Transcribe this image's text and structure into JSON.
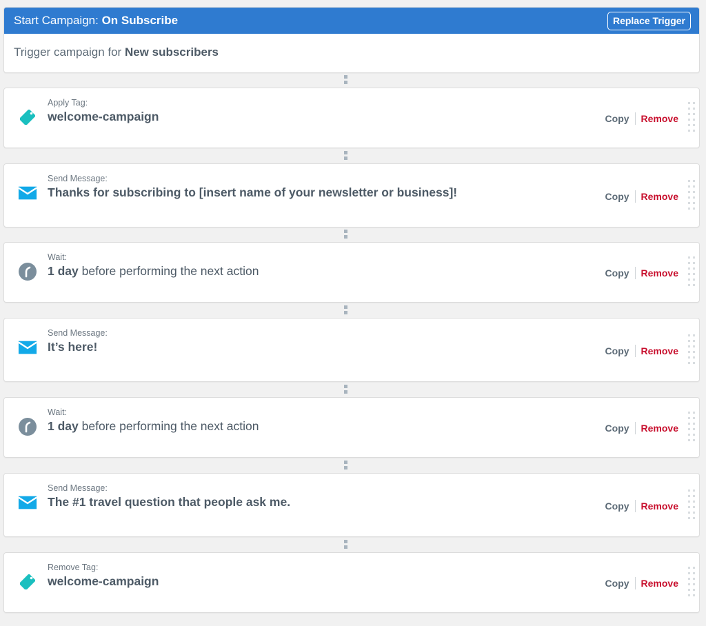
{
  "trigger": {
    "title_prefix": "Start Campaign:",
    "title_value": "On Subscribe",
    "replace_button": "Replace Trigger",
    "body_prefix": "Trigger campaign for",
    "body_value": "New subscribers",
    "header_color": "#2f7bd0"
  },
  "action_labels": {
    "copy": "Copy",
    "remove": "Remove"
  },
  "colors": {
    "tag_icon": "#1abfbf",
    "mail_icon": "#12a9e8",
    "clock_icon": "#7b8e9c",
    "remove": "#c8102e"
  },
  "steps": [
    {
      "type": "tag",
      "icon": "tag-icon",
      "label": "Apply Tag:",
      "value": "welcome-campaign",
      "suffix": ""
    },
    {
      "type": "message",
      "icon": "mail-icon",
      "label": "Send Message:",
      "value": "Thanks for subscribing to [insert name of your newsletter or business]!",
      "suffix": ""
    },
    {
      "type": "wait",
      "icon": "clock-icon",
      "label": "Wait:",
      "value": "1 day",
      "suffix": " before performing the next action"
    },
    {
      "type": "message",
      "icon": "mail-icon",
      "label": "Send Message:",
      "value": "It’s here!",
      "suffix": ""
    },
    {
      "type": "wait",
      "icon": "clock-icon",
      "label": "Wait:",
      "value": "1 day",
      "suffix": " before performing the next action"
    },
    {
      "type": "message",
      "icon": "mail-icon",
      "label": "Send Message:",
      "value": "The #1 travel question that people ask me.",
      "suffix": ""
    },
    {
      "type": "tag",
      "icon": "tag-icon",
      "label": "Remove Tag:",
      "value": "welcome-campaign",
      "suffix": ""
    }
  ]
}
